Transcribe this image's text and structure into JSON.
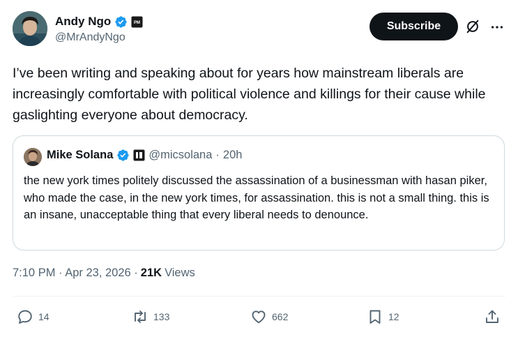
{
  "author": {
    "display_name": "Andy Ngo",
    "handle": "@MrAndyNgo",
    "verified_color": "#1d9bf0"
  },
  "header": {
    "subscribe_label": "Subscribe",
    "grok_icon": "grok-icon",
    "more_icon": "more-icon"
  },
  "tweet": {
    "text": "I’ve been writing and speaking about for years how mainstream liberals are increasingly comfortable with political violence and killings for their cause while gaslighting everyone about democracy."
  },
  "quote": {
    "display_name": "Mike Solana",
    "handle": "@micsolana",
    "separator": "·",
    "time": "20h",
    "text": "the new york times politely discussed the assassination of a businessman with hasan piker, who made the case, in the new york times, for assassination. this is not a small thing. this is an insane, unacceptable thing that every liberal needs to denounce."
  },
  "meta": {
    "timestamp": "7:10 PM · Apr 23, 2026 ·",
    "views_count": "21K",
    "views_label": "Views"
  },
  "actions": {
    "replies": "14",
    "reposts": "133",
    "likes": "662",
    "bookmarks": "12"
  }
}
